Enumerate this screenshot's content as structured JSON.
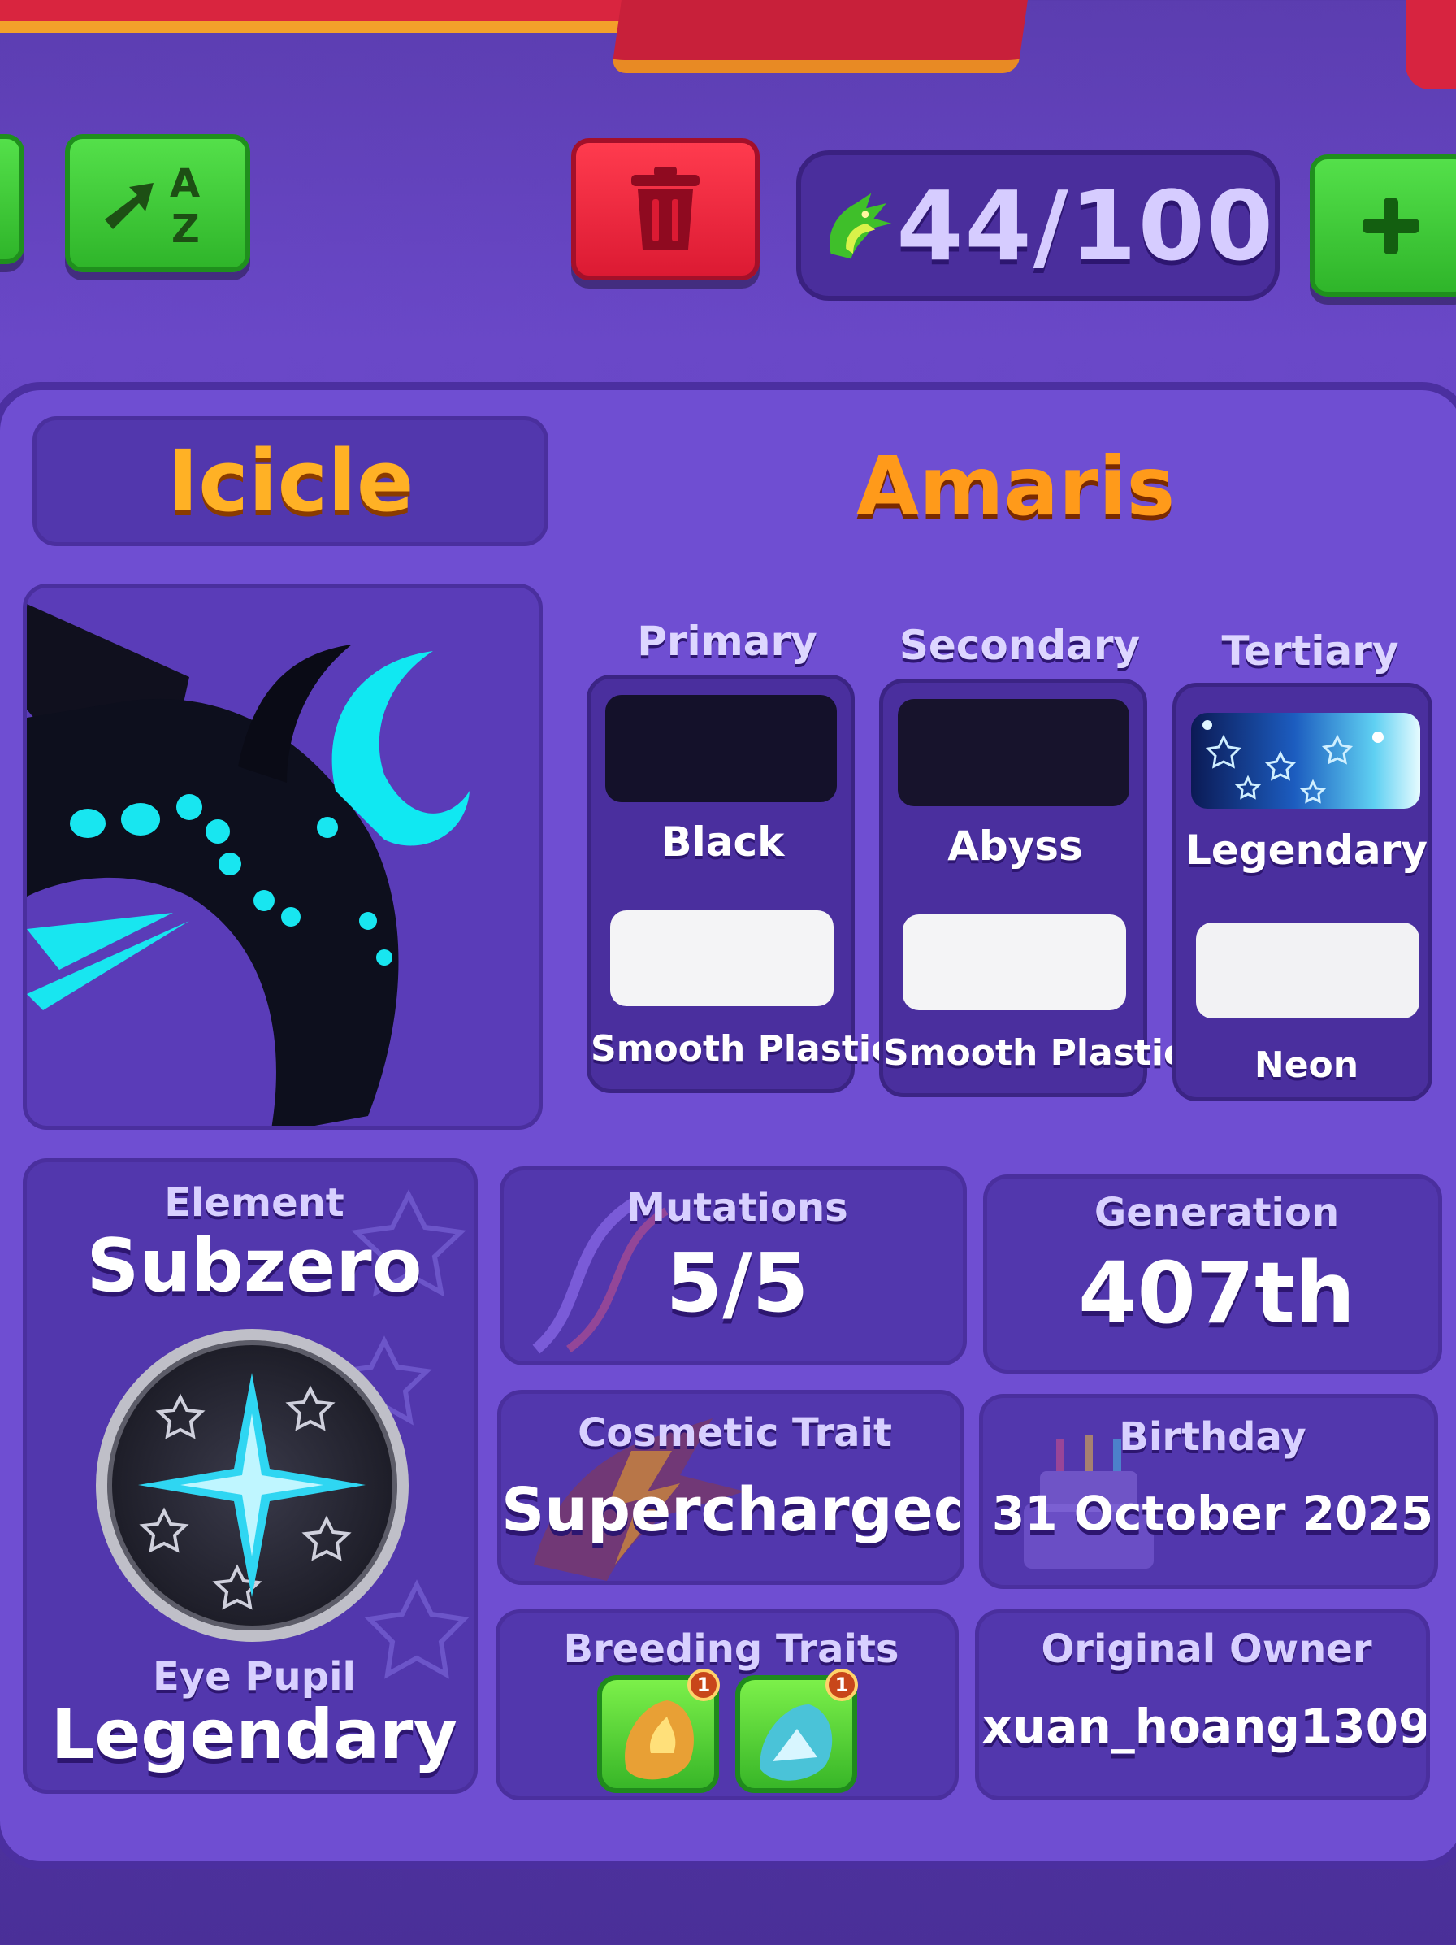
{
  "toolbar": {
    "counter": "44/100",
    "sort_icon": "a-z-sort-icon",
    "delete_icon": "trash-icon",
    "add_icon": "plus-icon",
    "counter_icon": "dragon-head-icon"
  },
  "dragon": {
    "name": "Icicle",
    "species": "Amaris"
  },
  "colors": {
    "headers": [
      "Primary",
      "Secondary",
      "Tertiary"
    ],
    "primary": {
      "color": "Black",
      "material": "Smooth Plastic",
      "color_hex": "#14112a",
      "material_hex": "#f4f4f6"
    },
    "secondary": {
      "color": "Abyss",
      "material": "Smooth Plastic",
      "color_hex": "#17132c",
      "material_hex": "#f4f4f6"
    },
    "tertiary": {
      "color": "Legendary",
      "material": "Neon",
      "material_hex": "#f2f2f4"
    }
  },
  "stats": {
    "element_label": "Element",
    "element_value": "Subzero",
    "eye_label": "Eye Pupil",
    "eye_value": "Legendary",
    "mutations_label": "Mutations",
    "mutations_value": "5/5",
    "generation_label": "Generation",
    "generation_value": "407th",
    "cosmetic_label": "Cosmetic Trait",
    "cosmetic_value": "Supercharged",
    "birthday_label": "Birthday",
    "birthday_value": "31 October 2025",
    "breeding_label": "Breeding Traits",
    "breeding_badge_1": "1",
    "breeding_badge_2": "1",
    "owner_label": "Original Owner",
    "owner_value": "xuan_hoang1309"
  }
}
